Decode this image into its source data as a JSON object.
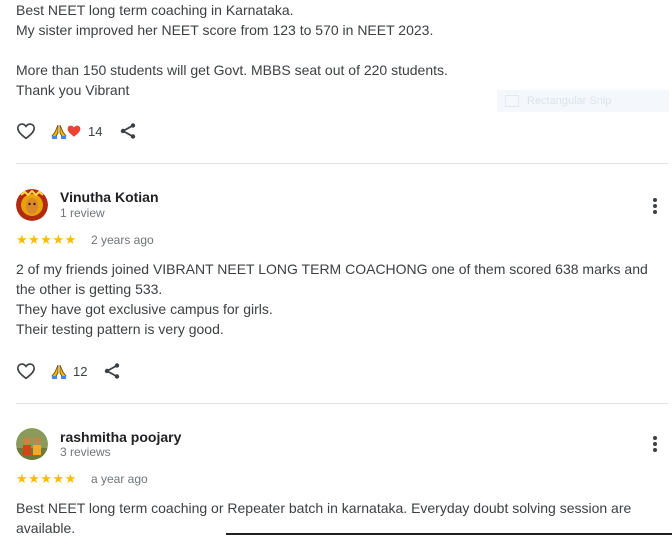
{
  "review1": {
    "lines": [
      "Best NEET long term coaching in Karnataka.",
      "My sister improved her NEET score from 123 to 570 in NEET 2023.",
      "More than 150 students will get Govt. MBBS seat out of 220 students.",
      "Thank you Vibrant"
    ],
    "reaction_count": "14"
  },
  "review2": {
    "name": "Vinutha Kotian",
    "subtitle": "1 review",
    "rating": 5,
    "stars": "★★★★★",
    "time": "2 years ago",
    "lines": [
      "2 of my friends joined VIBRANT NEET LONG TERM COACHONG one of them scored 638 marks and",
      "the other is getting 533.",
      "They have got exclusive campus for girls.",
      "Their testing pattern is very good."
    ],
    "reaction_count": "12"
  },
  "review3": {
    "name": "rashmitha poojary",
    "subtitle": "3 reviews",
    "rating": 5,
    "stars": "★★★★★",
    "time": "a year ago",
    "lines": [
      "Best NEET long term coaching or Repeater batch in karnataka. Everyday doubt solving session are",
      "available."
    ]
  },
  "overlay": {
    "label": "Rectangular Snip"
  },
  "icons": {
    "like": "heart-outline-icon",
    "pray": "folded-hands-icon",
    "love": "red-heart-icon",
    "share": "share-icon",
    "menu": "more-vert-icon"
  },
  "colors": {
    "star": "#fbbc04",
    "heart": "#ea4335",
    "text": "#3c4043",
    "divider": "#e0e0e0"
  }
}
